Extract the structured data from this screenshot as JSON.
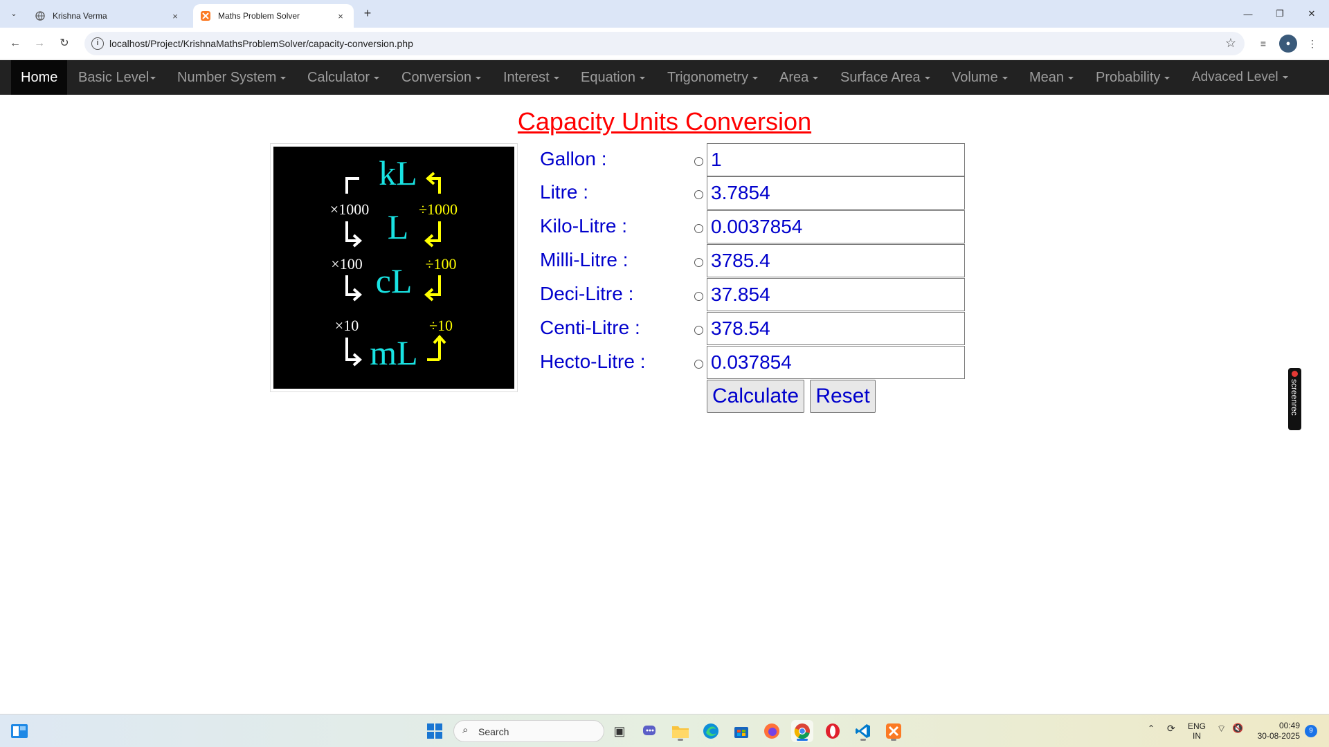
{
  "browser": {
    "tabs": [
      {
        "title": "Krishna Verma",
        "active": false
      },
      {
        "title": "Maths Problem Solver",
        "active": true
      }
    ],
    "url": "localhost/Project/KrishnaMathsProblemSolver/capacity-conversion.php",
    "close_glyph": "×",
    "new_tab_glyph": "+"
  },
  "nav": {
    "home": "Home",
    "items": [
      "Basic Level",
      "Number System",
      "Calculator",
      "Conversion",
      "Interest",
      "Equation",
      "Trigonometry",
      "Area",
      "Surface Area",
      "Volume",
      "Mean",
      "Probability",
      "Advaced Level"
    ]
  },
  "page": {
    "title": "Capacity Units Conversion",
    "diagram": {
      "units": [
        "kL",
        "L",
        "cL",
        "mL"
      ],
      "multipliers": [
        "×1000",
        "×100",
        "×10"
      ],
      "divisors": [
        "÷1000",
        "÷100",
        "÷10"
      ]
    },
    "fields": [
      {
        "label": "Gallon :",
        "value": "1"
      },
      {
        "label": "Litre :",
        "value": "3.7854"
      },
      {
        "label": "Kilo-Litre :",
        "value": "0.0037854"
      },
      {
        "label": "Milli-Litre :",
        "value": "3785.4"
      },
      {
        "label": "Deci-Litre :",
        "value": "37.854"
      },
      {
        "label": "Centi-Litre :",
        "value": "378.54"
      },
      {
        "label": "Hecto-Litre :",
        "value": "0.037854"
      }
    ],
    "buttons": {
      "calculate": "Calculate",
      "reset": "Reset"
    }
  },
  "overlay": {
    "screenrec": "screenrec"
  },
  "taskbar": {
    "search_placeholder": "Search",
    "lang_top": "ENG",
    "lang_bottom": "IN",
    "time": "00:49",
    "date": "30-08-2025",
    "notification_count": "9"
  },
  "colors": {
    "nav_bg": "#222222",
    "title_red": "#ff0000",
    "label_blue": "#0000cc",
    "diagram_cyan": "#19e3e3",
    "diagram_yellow": "#ffff00"
  }
}
